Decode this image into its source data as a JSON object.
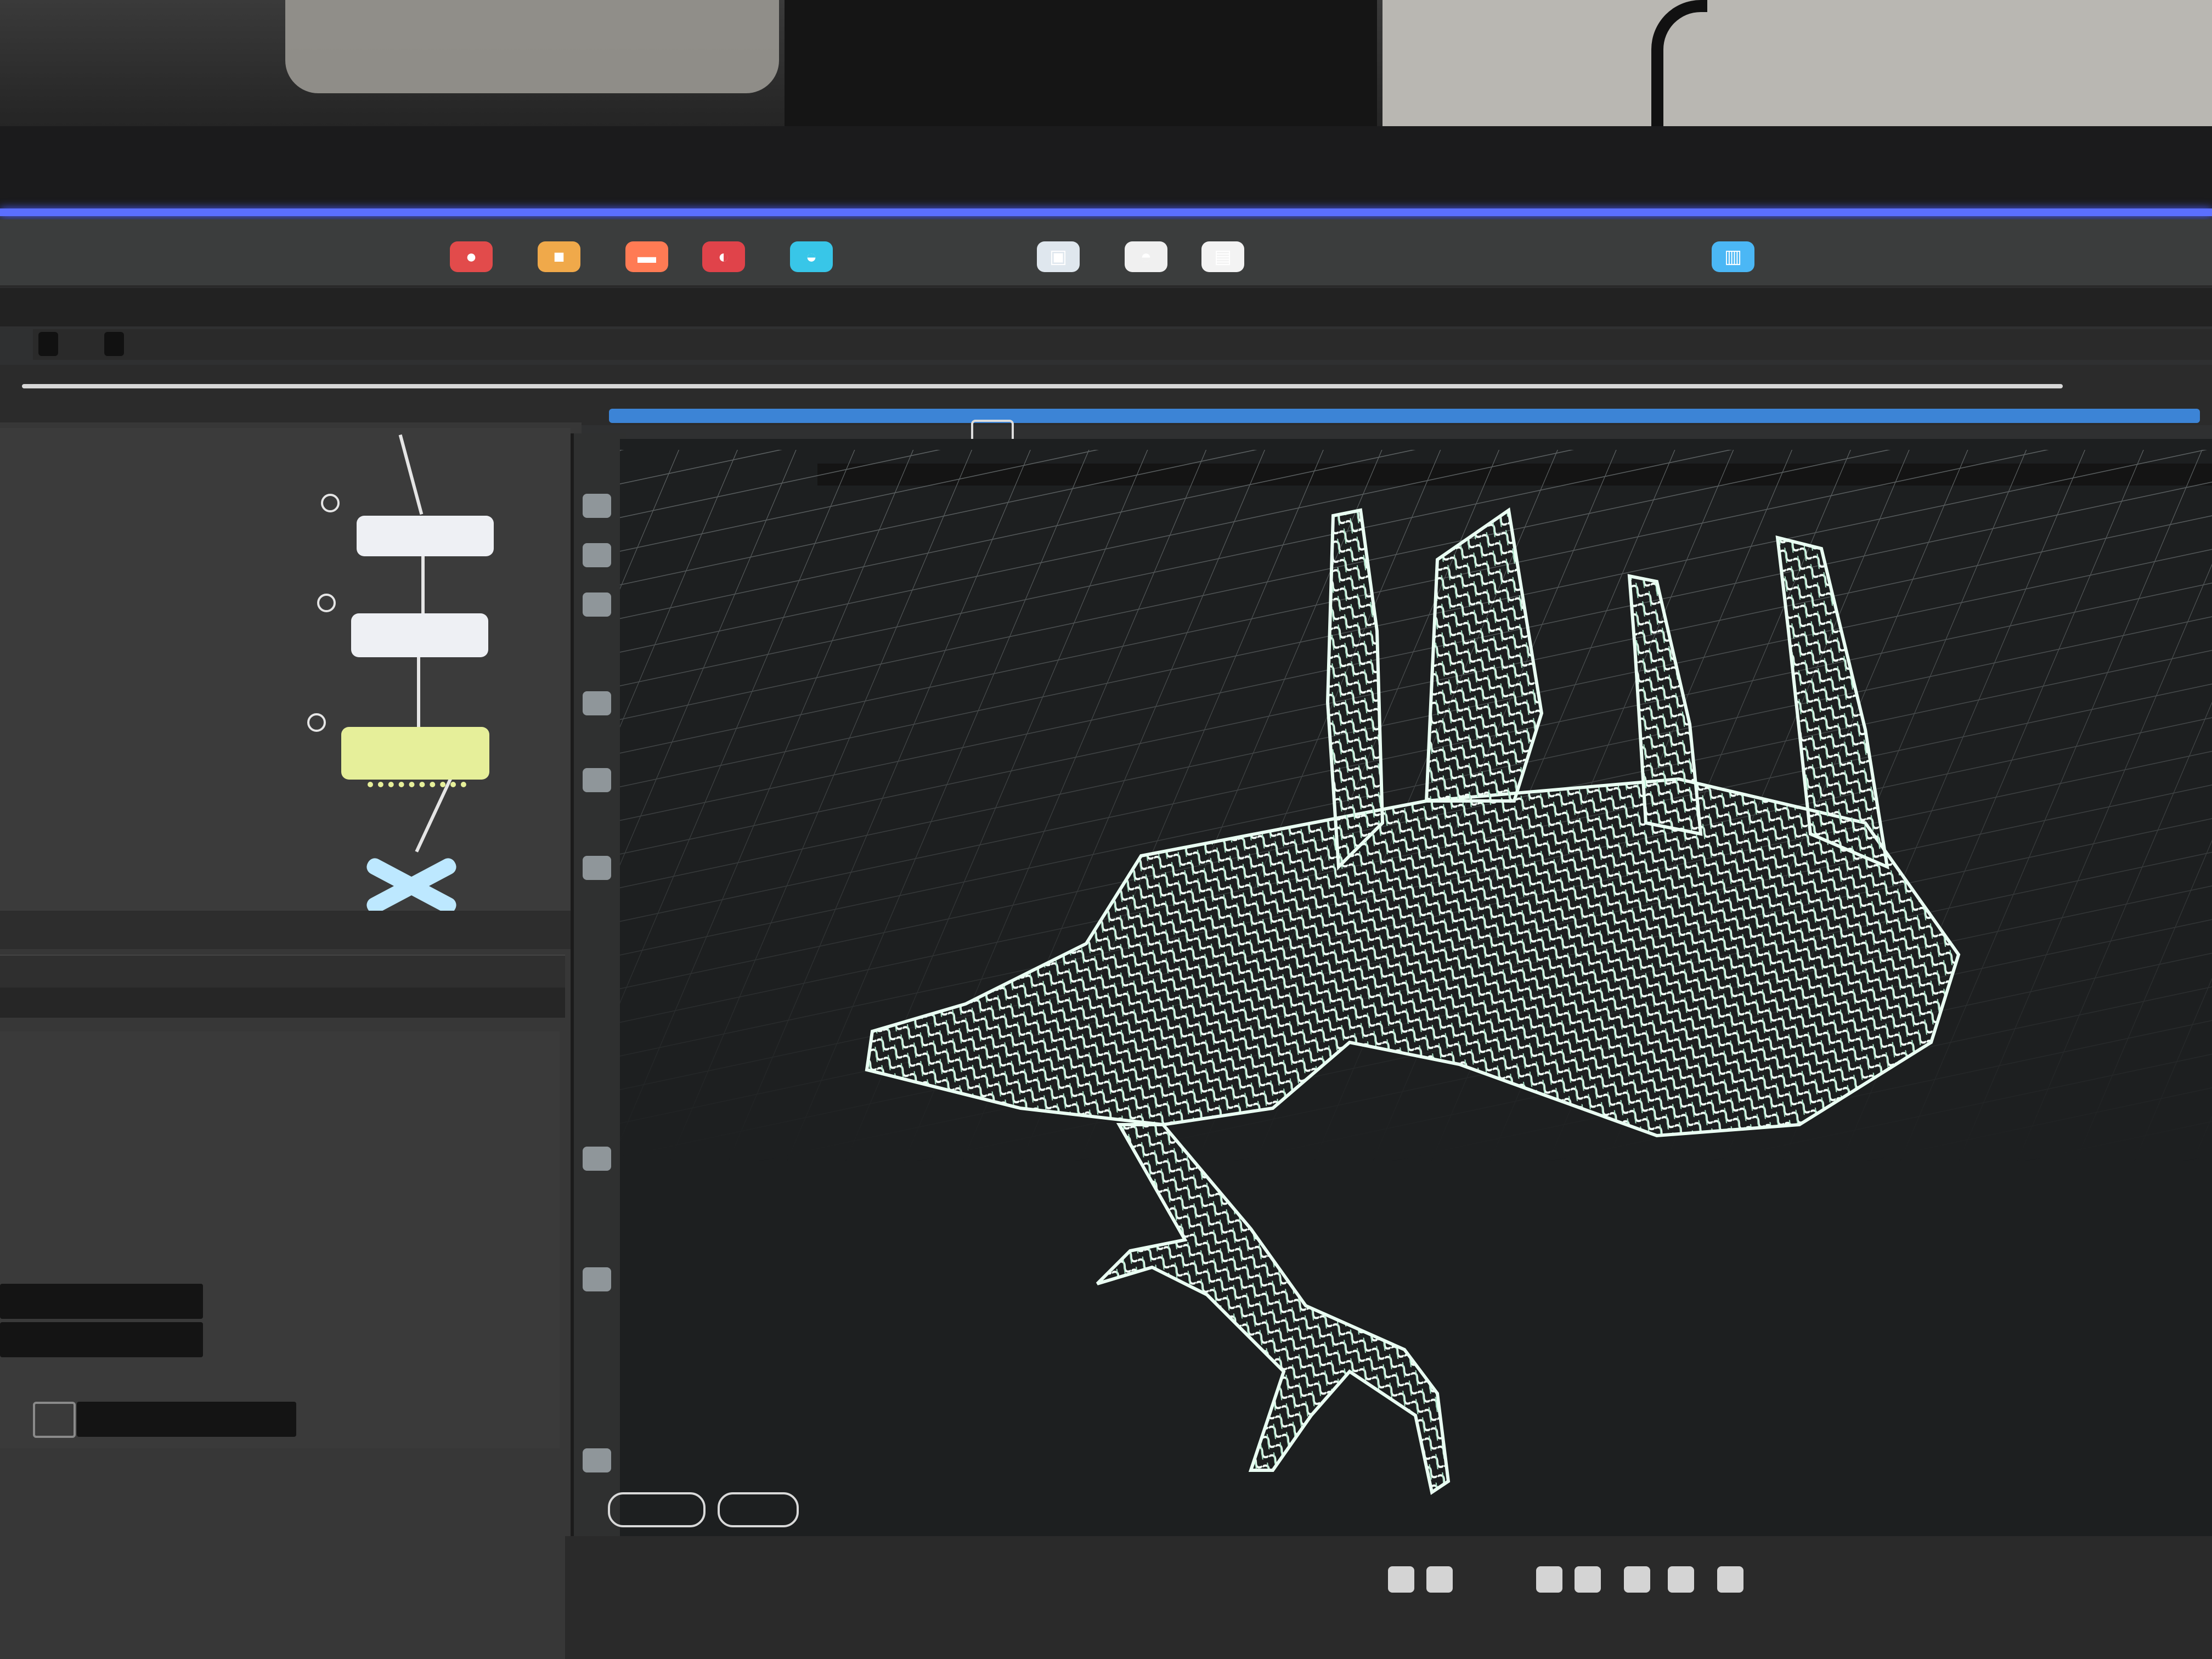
{
  "colors": {
    "accent": "#5b6fff",
    "timeline_progress": "#3c84d6",
    "mesh": "#d7f5e6",
    "mount_node": "#e6ef9a"
  },
  "toolbar": {
    "tools": [
      {
        "icon": "sphere-icon",
        "color": "#e24b4b"
      },
      {
        "icon": "box-icon",
        "color": "#f0a94a"
      },
      {
        "icon": "tube-icon",
        "color": "#ff7b54"
      },
      {
        "icon": "curve-icon",
        "color": "#e0434a"
      },
      {
        "icon": "light-icon",
        "color": "#38c6e8"
      },
      {
        "icon": "camera-icon",
        "color": "#dfe7ee"
      },
      {
        "icon": "null-icon",
        "color": "#f0f0f0"
      },
      {
        "icon": "grid-icon",
        "color": "#f3f3f3"
      },
      {
        "icon": "render-icon",
        "color": "#4bb7f5"
      }
    ]
  },
  "timeline": {
    "tabs": [
      "",
      ""
    ],
    "progress": 0.72
  },
  "node_graph": {
    "nodes": [
      {
        "label": "",
        "icon": "node-icon"
      },
      {
        "label": "",
        "icon": "node-icon"
      },
      {
        "label": "",
        "sublabel": "",
        "icon": "mount-node-icon"
      },
      {
        "label": "",
        "icon": "output-x-icon"
      }
    ]
  },
  "viewport": {
    "buttons": [
      "",
      ""
    ],
    "object": "wireframe-mesh-model"
  }
}
